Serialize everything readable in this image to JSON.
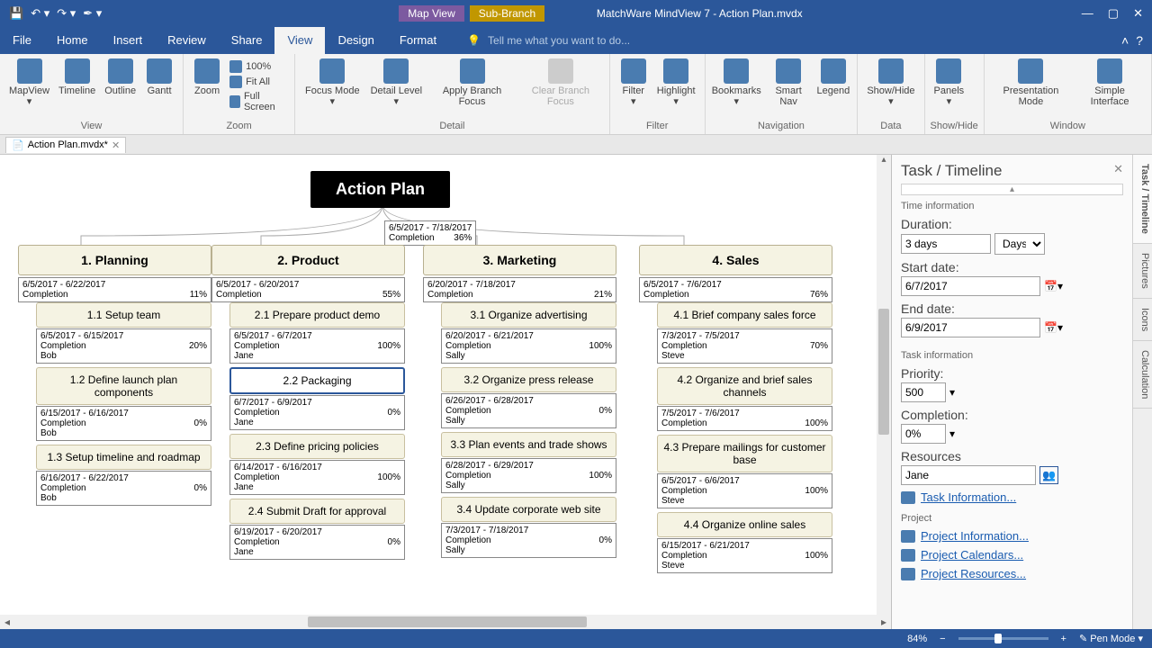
{
  "title": "MatchWare MindView 7 - Action Plan.mvdx",
  "context_tabs": [
    "Map View",
    "Sub-Branch"
  ],
  "tabs": [
    "File",
    "Home",
    "Insert",
    "Review",
    "Share",
    "View",
    "Design",
    "Format"
  ],
  "tell_me": "Tell me what you want to do...",
  "ribbon": {
    "view": {
      "mapview": "MapView",
      "timeline": "Timeline",
      "outline": "Outline",
      "gantt": "Gantt",
      "group": "View"
    },
    "zoom": {
      "zoom": "Zoom",
      "pct": "100%",
      "fitall": "Fit All",
      "fullscreen": "Full Screen",
      "group": "Zoom"
    },
    "detail": {
      "focus": "Focus Mode",
      "detail": "Detail Level",
      "apply": "Apply Branch Focus",
      "clear": "Clear Branch Focus",
      "group": "Detail"
    },
    "filter": {
      "filter": "Filter",
      "highlight": "Highlight",
      "group": "Filter"
    },
    "nav": {
      "bookmarks": "Bookmarks",
      "smartnav": "Smart Nav",
      "legend": "Legend",
      "group": "Navigation"
    },
    "data": {
      "showhide": "Show/Hide",
      "group": "Data"
    },
    "sh": {
      "panels": "Panels",
      "group": "Show/Hide"
    },
    "window": {
      "pres": "Presentation Mode",
      "simple": "Simple Interface",
      "group": "Window"
    }
  },
  "doc_tab": "Action Plan.mvdx*",
  "root": {
    "title": "Action Plan",
    "dates": "6/5/2017 - 7/18/2017",
    "completion": "36%"
  },
  "columns": [
    {
      "head": "1.  Planning",
      "dates": "6/5/2017 - 6/22/2017",
      "completion": "11%",
      "tasks": [
        {
          "t": "1.1  Setup team",
          "d": "6/5/2017 - 6/15/2017",
          "c": "20%",
          "r": "Bob"
        },
        {
          "t": "1.2  Define launch plan components",
          "d": "6/15/2017 - 6/16/2017",
          "c": "0%",
          "r": "Bob"
        },
        {
          "t": "1.3  Setup timeline and roadmap",
          "d": "6/16/2017 - 6/22/2017",
          "c": "0%",
          "r": "Bob"
        }
      ]
    },
    {
      "head": "2.  Product",
      "dates": "6/5/2017 - 6/20/2017",
      "completion": "55%",
      "tasks": [
        {
          "t": "2.1  Prepare product demo",
          "d": "6/5/2017 - 6/7/2017",
          "c": "100%",
          "r": "Jane"
        },
        {
          "t": "2.2  Packaging",
          "d": "6/7/2017 - 6/9/2017",
          "c": "0%",
          "r": "Jane",
          "selected": true
        },
        {
          "t": "2.3  Define pricing policies",
          "d": "6/14/2017 - 6/16/2017",
          "c": "100%",
          "r": "Jane"
        },
        {
          "t": "2.4  Submit Draft for approval",
          "d": "6/19/2017 - 6/20/2017",
          "c": "0%",
          "r": "Jane"
        }
      ]
    },
    {
      "head": "3.  Marketing",
      "dates": "6/20/2017 - 7/18/2017",
      "completion": "21%",
      "tasks": [
        {
          "t": "3.1  Organize advertising",
          "d": "6/20/2017 - 6/21/2017",
          "c": "100%",
          "r": "Sally"
        },
        {
          "t": "3.2  Organize press release",
          "d": "6/26/2017 - 6/28/2017",
          "c": "0%",
          "r": "Sally"
        },
        {
          "t": "3.3  Plan events and trade shows",
          "d": "6/28/2017 - 6/29/2017",
          "c": "100%",
          "r": "Sally"
        },
        {
          "t": "3.4  Update corporate web site",
          "d": "7/3/2017 - 7/18/2017",
          "c": "0%",
          "r": "Sally"
        }
      ]
    },
    {
      "head": "4.  Sales",
      "dates": "6/5/2017 - 7/6/2017",
      "completion": "76%",
      "tasks": [
        {
          "t": "4.1  Brief company sales force",
          "d": "7/3/2017 - 7/5/2017",
          "c": "70%",
          "r": "Steve"
        },
        {
          "t": "4.2  Organize and brief sales channels",
          "d": "7/5/2017 - 7/6/2017",
          "c": "100%",
          "r": ""
        },
        {
          "t": "4.3  Prepare mailings for customer base",
          "d": "6/5/2017 - 6/6/2017",
          "c": "100%",
          "r": "Steve"
        },
        {
          "t": "4.4  Organize online sales",
          "d": "6/15/2017 - 6/21/2017",
          "c": "100%",
          "r": "Steve"
        }
      ]
    }
  ],
  "panel": {
    "title": "Task / Timeline",
    "time_section": "Time information",
    "duration_label": "Duration:",
    "duration_val": "3 days",
    "duration_unit": "Days",
    "start_label": "Start date:",
    "start_val": "6/7/2017",
    "end_label": "End date:",
    "end_val": "6/9/2017",
    "task_section": "Task information",
    "priority_label": "Priority:",
    "priority_val": "500",
    "completion_label": "Completion:",
    "completion_val": "0%",
    "resources_label": "Resources",
    "resources_val": "Jane",
    "task_info_link": "Task Information...",
    "project_section": "Project",
    "proj_info": "Project Information...",
    "proj_cal": "Project Calendars...",
    "proj_res": "Project Resources..."
  },
  "side_tabs": [
    "Task / Timeline",
    "Pictures",
    "Icons",
    "Calculation"
  ],
  "status": {
    "zoom": "84%",
    "pen": "Pen Mode"
  },
  "labels": {
    "completion": "Completion"
  }
}
